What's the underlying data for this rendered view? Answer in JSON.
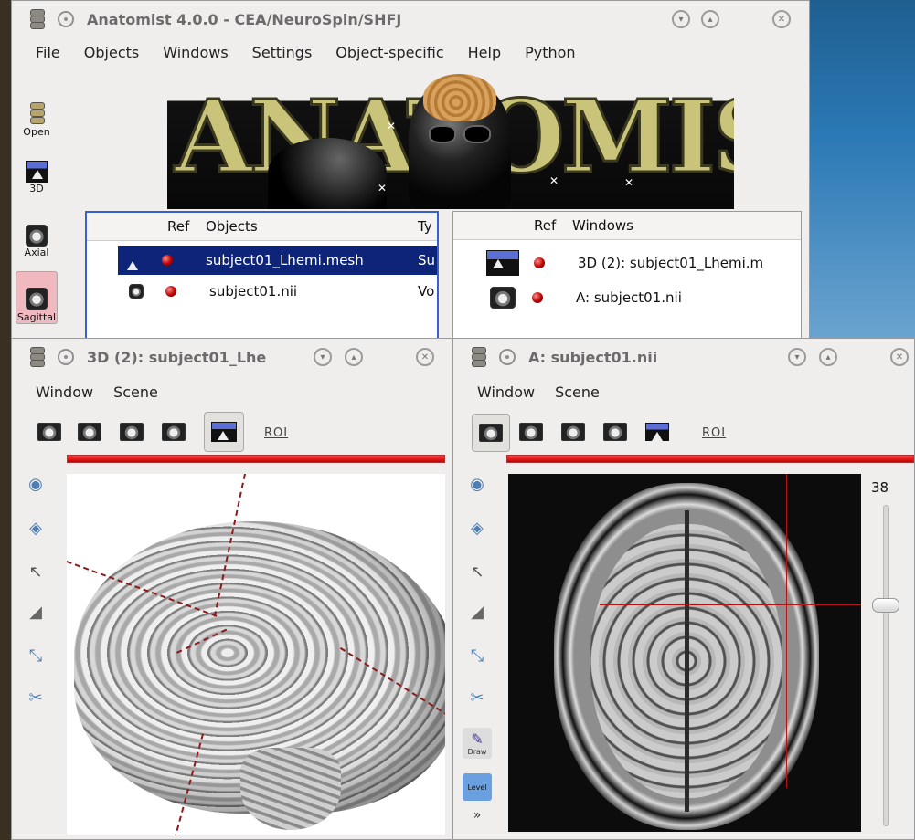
{
  "main": {
    "title": "Anatomist 4.0.0 - CEA/NeuroSpin/SHFJ",
    "menu": [
      "File",
      "Objects",
      "Windows",
      "Settings",
      "Object-specific",
      "Help",
      "Python"
    ],
    "sidebar": [
      "Open",
      "3D",
      "Axial",
      "Sagittal"
    ],
    "objects_panel": {
      "headers": [
        "Ref",
        "Objects",
        "Ty"
      ],
      "rows": [
        {
          "name": "subject01_Lhemi.mesh",
          "type": "Su",
          "selected": true
        },
        {
          "name": "subject01.nii",
          "type": "Vo",
          "selected": false
        }
      ]
    },
    "windows_panel": {
      "headers": [
        "Ref",
        "Windows"
      ],
      "rows": [
        {
          "name": "3D (2): subject01_Lhemi.m"
        },
        {
          "name": "A: subject01.nii"
        }
      ]
    }
  },
  "win3d": {
    "title": "3D (2): subject01_Lhe",
    "menu": [
      "Window",
      "Scene"
    ],
    "roi": "ROI"
  },
  "winA": {
    "title": "A: subject01.nii",
    "menu": [
      "Window",
      "Scene"
    ],
    "roi": "ROI",
    "slice_value": "38",
    "tools": [
      "Draw",
      "Level"
    ]
  },
  "colors": {
    "selection": "#0e2478",
    "crosshair": "#b31515",
    "refbar": "#e01818"
  }
}
